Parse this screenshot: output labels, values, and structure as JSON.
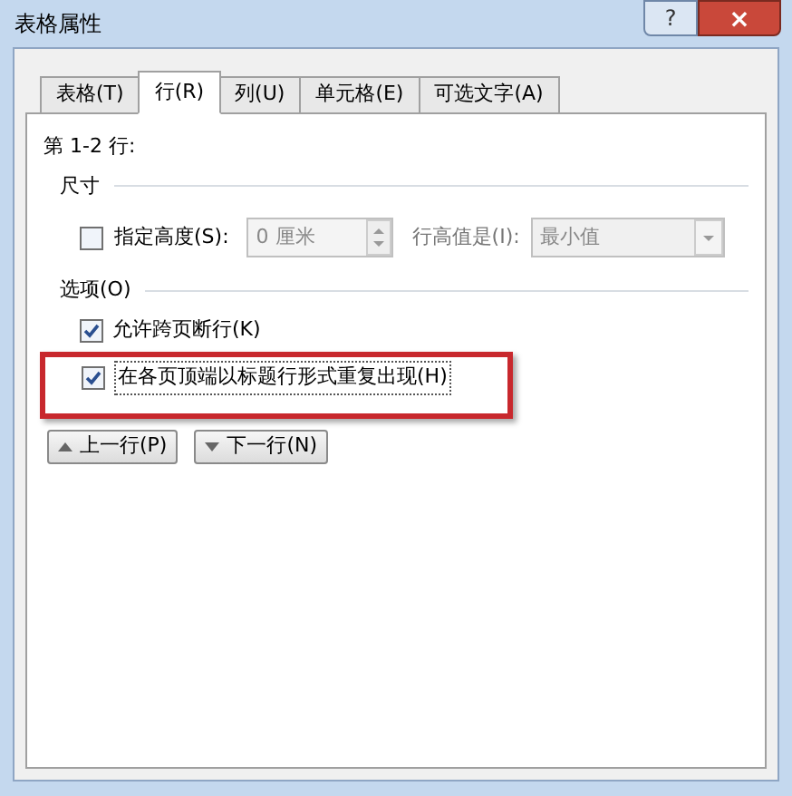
{
  "window": {
    "title": "表格属性",
    "help": "?",
    "close": "×"
  },
  "tabs": [
    {
      "label": "表格(T)",
      "selected": false
    },
    {
      "label": "行(R)",
      "selected": true
    },
    {
      "label": "列(U)",
      "selected": false
    },
    {
      "label": "单元格(E)",
      "selected": false
    },
    {
      "label": "可选文字(A)",
      "selected": false
    }
  ],
  "rows_label": "第 1-2 行:",
  "size": {
    "heading": "尺寸",
    "height_checkbox": {
      "label": "指定高度(S):",
      "checked": false
    },
    "height_field": {
      "value": "0 厘米",
      "disabled": true
    },
    "rule_label": "行高值是(I):",
    "rule_select": {
      "value": "最小值",
      "disabled": true
    }
  },
  "options": {
    "heading": "选项(O)",
    "checkboxes": [
      {
        "label": "允许跨页断行(K)",
        "checked": true,
        "highlighted": false
      },
      {
        "label": "在各页顶端以标题行形式重复出现(H)",
        "checked": true,
        "highlighted": true
      }
    ]
  },
  "nav_buttons": [
    {
      "label": "上一行(P)",
      "kind": "up"
    },
    {
      "label": "下一行(N)",
      "kind": "down"
    }
  ]
}
